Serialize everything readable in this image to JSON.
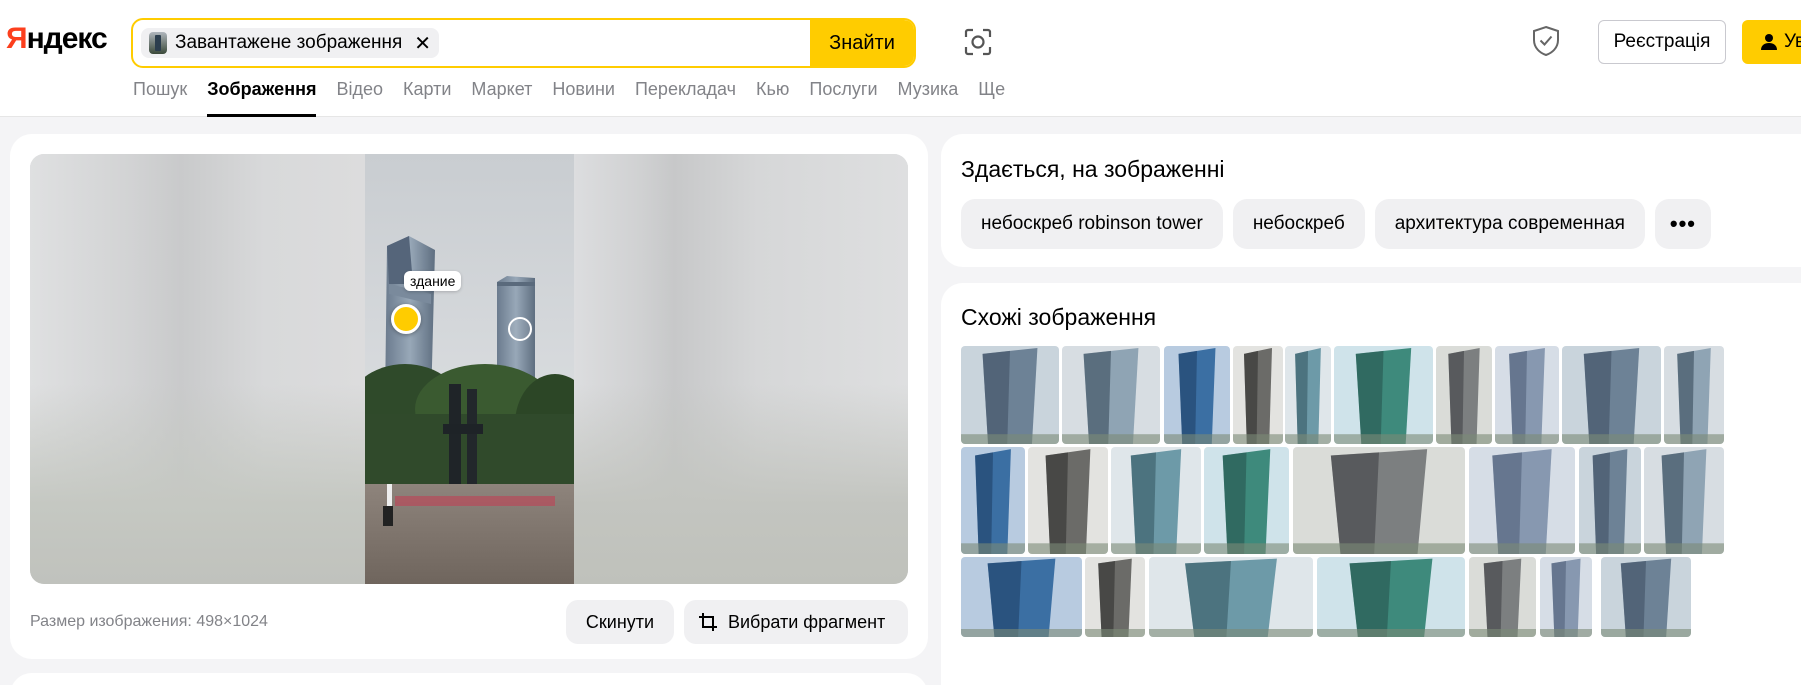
{
  "header": {
    "logo": "Яндекс",
    "search_chip_label": "Завантажене зображення",
    "chip_close": "✕",
    "search_button": "Знайти",
    "register_button": "Реєстрація",
    "login_button": "Ув"
  },
  "tabs": [
    {
      "label": "Пошук"
    },
    {
      "label": "Зображення"
    },
    {
      "label": "Відео"
    },
    {
      "label": "Карти"
    },
    {
      "label": "Маркет"
    },
    {
      "label": "Новини"
    },
    {
      "label": "Перекладач"
    },
    {
      "label": "Кью"
    },
    {
      "label": "Послуги"
    },
    {
      "label": "Музика"
    },
    {
      "label": "Ще"
    }
  ],
  "active_tab": "Зображення",
  "preview": {
    "object_label": "здание",
    "size_text": "Размер изображения: 498×1024",
    "reset_button": "Скинути",
    "crop_button": "Вибрати фрагмент"
  },
  "tags_section": {
    "title": "Здається, на зображенні",
    "tags": [
      {
        "label": "небоскреб robinson tower"
      },
      {
        "label": "небоскреб"
      },
      {
        "label": "архитектура современная"
      }
    ],
    "more_label": "•••"
  },
  "similar_section": {
    "title": "Схожі зображення"
  },
  "colors": {
    "accent": "#ffcc00",
    "logo_red": "#fc3f1d",
    "muted_text": "#828388",
    "chip_bg": "#f0f0f2"
  }
}
